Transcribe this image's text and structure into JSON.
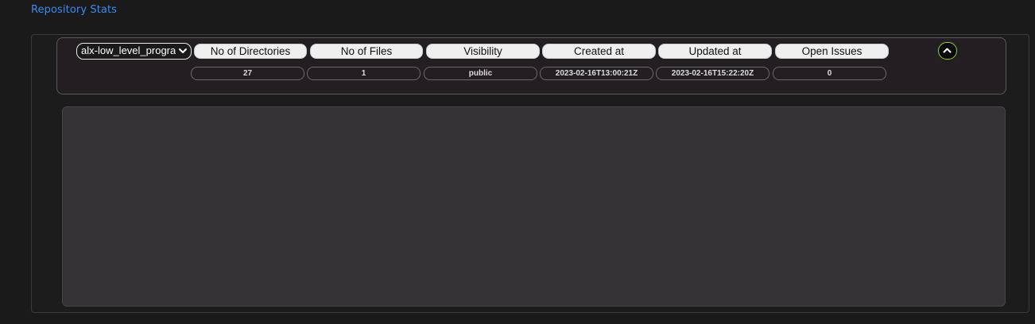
{
  "section": {
    "title": "Repository Stats"
  },
  "repo_select": {
    "selected": "alx-low_level_programming"
  },
  "stats": {
    "headers": [
      "No of Directories",
      "No of Files",
      "Visibility",
      "Created at",
      "Updated at",
      "Open Issues"
    ],
    "values": [
      "27",
      "1",
      "public",
      "2023-02-16T13:00:21Z",
      "2023-02-16T15:22:20Z",
      "0"
    ]
  },
  "icons": {
    "select_arrow": "chevron-down-icon",
    "collapse": "chevron-up-icon"
  },
  "colors": {
    "title": "#3b8bf5",
    "collapse_border": "#9acd32",
    "content_panel": "#343234",
    "header_pill": "#efefef"
  }
}
